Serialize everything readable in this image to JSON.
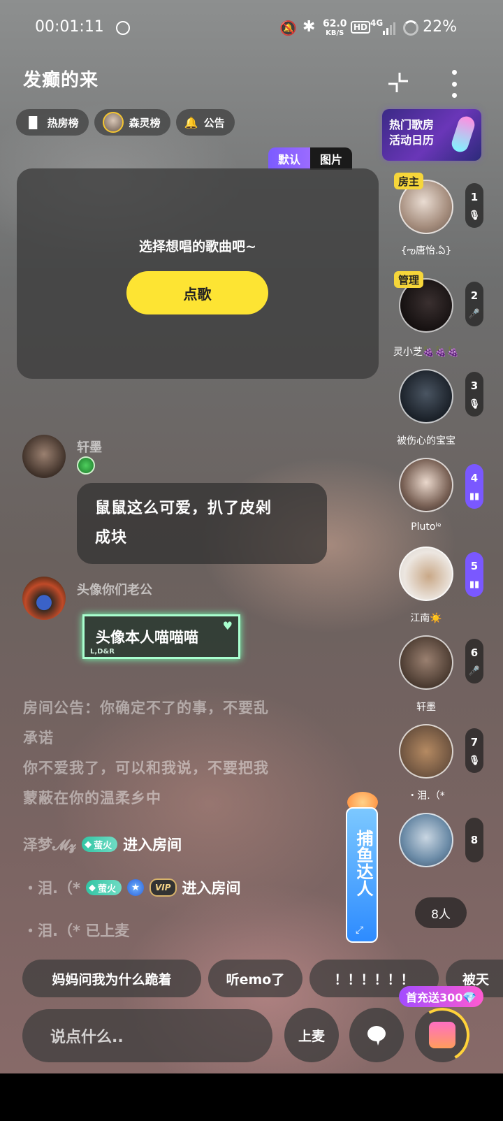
{
  "status_bar": {
    "time": "00:01:11",
    "net_speed_value": "62.0",
    "net_speed_unit": "KB/S",
    "hd": "HD",
    "signal": "4G",
    "battery": "22%"
  },
  "header": {
    "room_title": "发癫的来",
    "tags": [
      {
        "label": "热房榜",
        "icon": "bar-chart-icon"
      },
      {
        "label": "森灵榜",
        "icon": "crown-avatar"
      },
      {
        "label": "公告",
        "icon": "bell-icon"
      }
    ],
    "promo_text_line1": "热门歌房",
    "promo_text_line2": "活动日历"
  },
  "song_panel": {
    "tabs": [
      "默认",
      "图片"
    ],
    "prompt": "选择想唱的歌曲吧~",
    "button": "点歌"
  },
  "seats": [
    {
      "number": "1",
      "name": "{ఌ唐怡.ఏ}",
      "badge": "房主",
      "mic": "muted",
      "active": false
    },
    {
      "number": "2",
      "name": "灵小芝🍇🍇🍇",
      "badge": "管理",
      "mic": "on",
      "active": false
    },
    {
      "number": "3",
      "name": "被伤心的宝宝",
      "badge": "",
      "mic": "muted",
      "active": false
    },
    {
      "number": "4",
      "name": "Plutoᴵᵉ",
      "badge": "",
      "mic": "speaking",
      "active": true
    },
    {
      "number": "5",
      "name": "江南☀️",
      "badge": "",
      "mic": "speaking",
      "active": true
    },
    {
      "number": "6",
      "name": "轩墨",
      "badge": "",
      "mic": "on",
      "active": false
    },
    {
      "number": "7",
      "name": "・泪.（*",
      "badge": "",
      "mic": "muted",
      "active": false
    },
    {
      "number": "8",
      "name": "",
      "badge": "",
      "mic": "",
      "active": false
    }
  ],
  "chat": {
    "messages": [
      {
        "user": "轩墨",
        "text_line1": "鼠鼠这么可爱，扒了皮剁",
        "text_line2": "成块"
      },
      {
        "user": "头像你们老公",
        "text": "头像本人喵喵喵",
        "bubble_sub": "L,D&R"
      }
    ],
    "notice_line1": "房间公告：你确定不了的事，不要乱",
    "notice_line2": "承诺",
    "notice_line3": "你不爱我了，可以和我说，不要把我",
    "notice_line4": "蒙蔽在你的温柔乡中",
    "events": [
      {
        "user": "泽梦𝓜𝔃",
        "badge": "萤火",
        "action": "进入房间"
      },
      {
        "user": "・泪.（*",
        "badge": "萤火",
        "vip": "VIP",
        "action": "进入房间"
      },
      {
        "user": "・泪.（* 已上麦"
      }
    ]
  },
  "fish_banner": {
    "text": "捕鱼达人"
  },
  "people_count": "8人",
  "quick_replies": [
    "妈妈问我为什么跪着",
    "听emo了",
    "！！！！！！",
    "被天"
  ],
  "bottom_bar": {
    "input_placeholder": "说点什么..",
    "mic_button": "上麦",
    "first_charge": "首充送300💎"
  },
  "colors": {
    "accent_yellow": "#fde433",
    "accent_purple": "#7a58ff",
    "admin_badge": "#f6d63a"
  }
}
